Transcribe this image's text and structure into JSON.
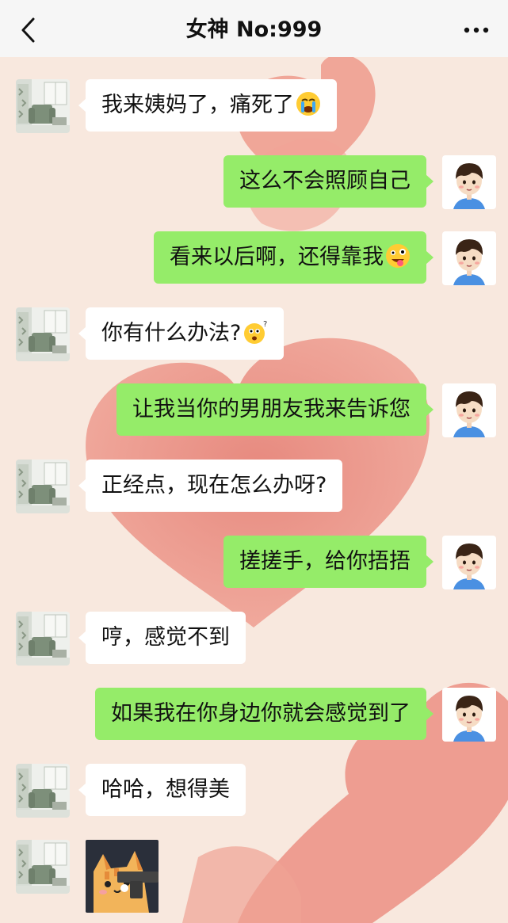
{
  "header": {
    "title": "女神 No:999"
  },
  "messages": [
    {
      "side": "left",
      "text": "我来姨妈了，痛死了",
      "emoji": "crying-face-emoji"
    },
    {
      "side": "right",
      "text": "这么不会照顾自己"
    },
    {
      "side": "right",
      "text": "看来以后啊，还得靠我",
      "emoji": "zany-face-emoji"
    },
    {
      "side": "left",
      "text": "你有什么办法?",
      "emoji": "thinking-face-emoji"
    },
    {
      "side": "right",
      "text": "让我当你的男朋友我来告诉您"
    },
    {
      "side": "left",
      "text": "正经点，现在怎么办呀?"
    },
    {
      "side": "right",
      "text": "搓搓手，给你捂捂"
    },
    {
      "side": "left",
      "text": "哼，感觉不到"
    },
    {
      "side": "right",
      "text": "如果我在你身边你就会感觉到了"
    },
    {
      "side": "left",
      "text": "哈哈，想得美"
    },
    {
      "side": "left",
      "sticker": "cat-with-gun-sticker"
    }
  ],
  "colors": {
    "sent_bubble": "#95ec69",
    "received_bubble": "#ffffff",
    "header_bg": "#f6f6f6",
    "wallpaper": "#f7e6dc",
    "heart": "#ea8d80"
  }
}
